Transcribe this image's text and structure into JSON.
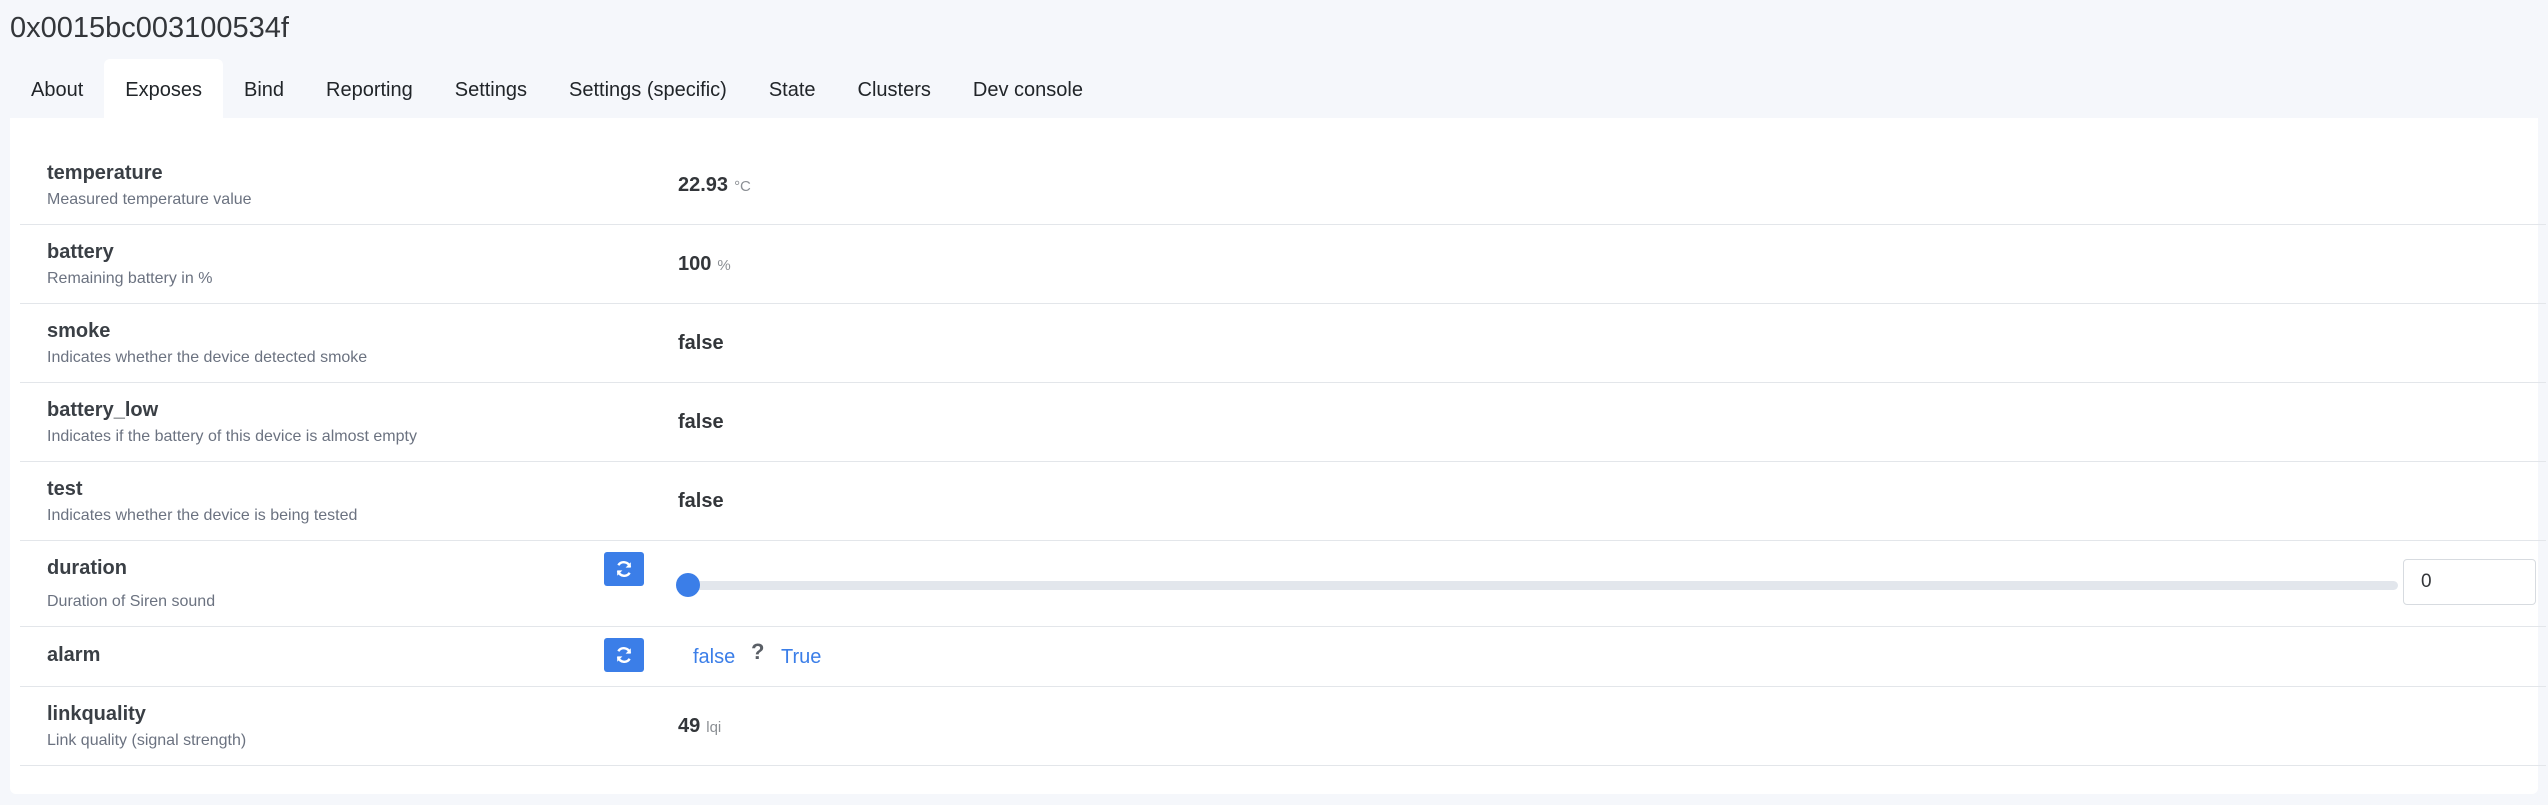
{
  "header": {
    "title": "0x0015bc003100534f"
  },
  "tabs": [
    {
      "label": "About"
    },
    {
      "label": "Exposes"
    },
    {
      "label": "Bind"
    },
    {
      "label": "Reporting"
    },
    {
      "label": "Settings"
    },
    {
      "label": "Settings (specific)"
    },
    {
      "label": "State"
    },
    {
      "label": "Clusters"
    },
    {
      "label": "Dev console"
    }
  ],
  "exposes": {
    "temperature": {
      "name": "temperature",
      "description": "Measured temperature value",
      "value": "22.93",
      "unit": "°C"
    },
    "battery": {
      "name": "battery",
      "description": "Remaining battery in %",
      "value": "100",
      "unit": "%"
    },
    "smoke": {
      "name": "smoke",
      "description": "Indicates whether the device detected smoke",
      "value": "false"
    },
    "battery_low": {
      "name": "battery_low",
      "description": "Indicates if the battery of this device is almost empty",
      "value": "false"
    },
    "test": {
      "name": "test",
      "description": "Indicates whether the device is being tested",
      "value": "false"
    },
    "duration": {
      "name": "duration",
      "description": "Duration of Siren sound",
      "value": "0",
      "slider_fraction": 0
    },
    "alarm": {
      "name": "alarm",
      "false_label": "false",
      "unknown_label": "?",
      "true_label": "True"
    },
    "linkquality": {
      "name": "linkquality",
      "description": "Link quality (signal strength)",
      "value": "49",
      "unit": "lqi"
    }
  },
  "colors": {
    "accent": "#3b7ee8",
    "background": "#f5f7fb"
  },
  "icons": {
    "refresh": "refresh-icon"
  }
}
